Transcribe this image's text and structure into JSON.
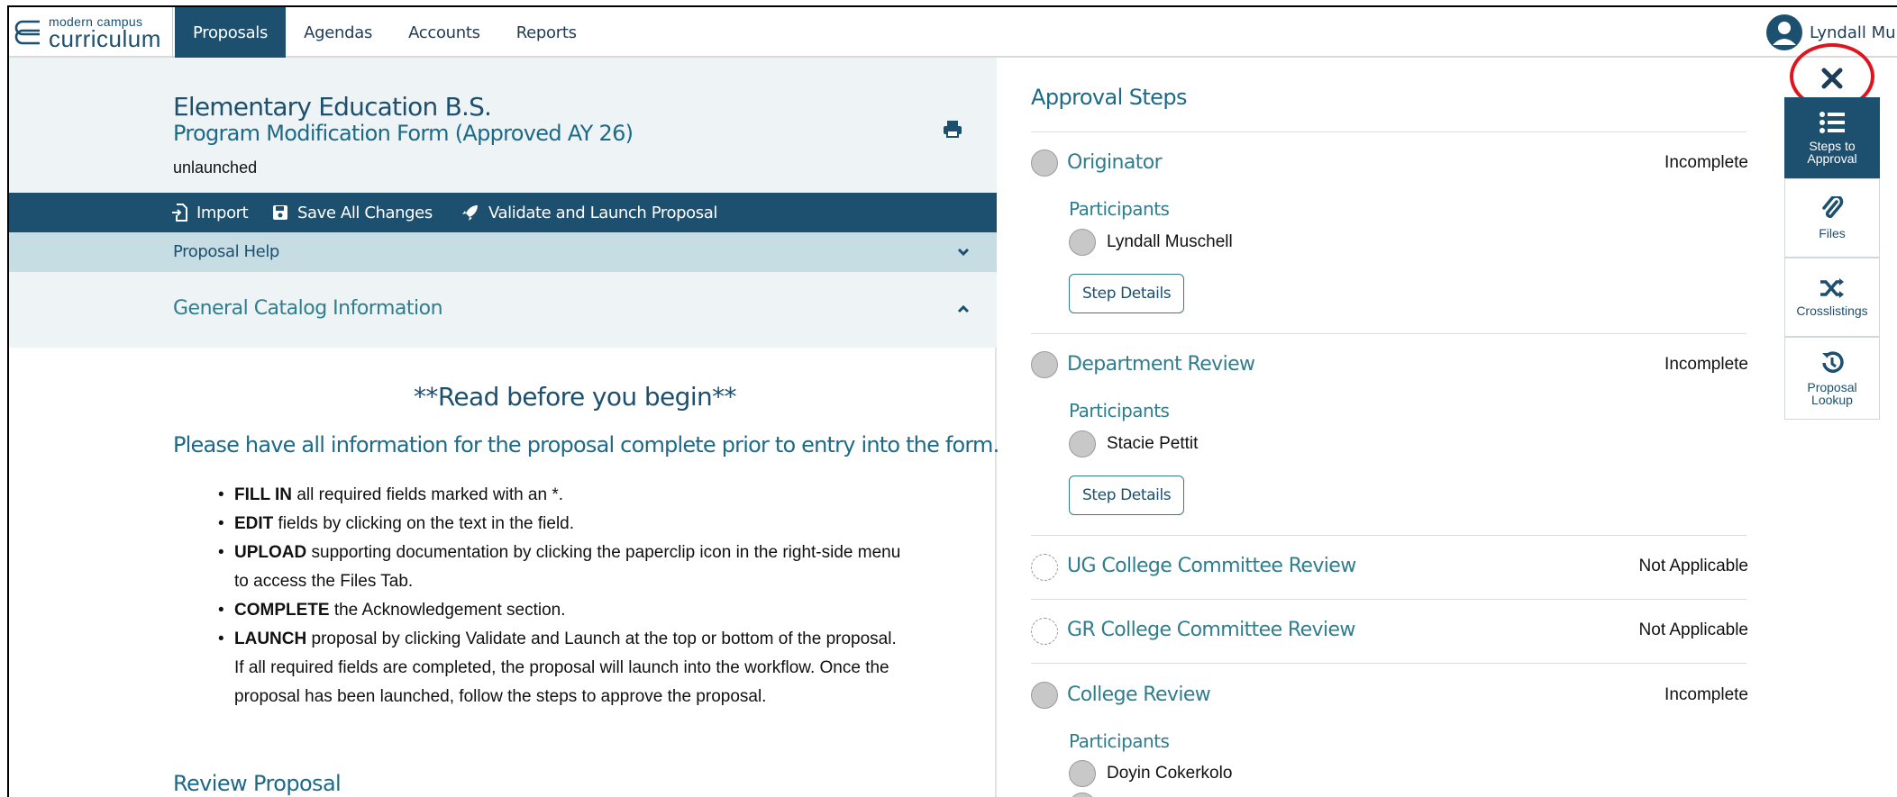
{
  "nav": {
    "logo_top": "modern campus",
    "logo_bottom": "curriculum",
    "tabs": [
      "Proposals",
      "Agendas",
      "Accounts",
      "Reports"
    ],
    "user": "Lyndall Mu"
  },
  "header": {
    "program_title": "Elementary Education B.S.",
    "form_name": "Program Modification Form (Approved AY 26)",
    "status": "unlaunched"
  },
  "actions": {
    "import": "Import",
    "save": "Save All Changes",
    "validate": "Validate and Launch Proposal"
  },
  "sections": {
    "help": "Proposal Help",
    "catalog": "General Catalog Information"
  },
  "content": {
    "read_heading": "**Read before you begin**",
    "please": "Please have all information for the proposal complete prior to entry into the form.",
    "instructions": [
      {
        "bold": "FILL IN",
        "text": " all required fields marked with an *."
      },
      {
        "bold": "EDIT",
        "text": " fields by clicking on the text in the field."
      },
      {
        "bold": "UPLOAD",
        "text": " supporting documentation by clicking the paperclip icon in the right-side menu to access the Files Tab."
      },
      {
        "bold": "COMPLETE",
        "text": " the Acknowledgement section."
      },
      {
        "bold": "LAUNCH",
        "text": " proposal by clicking Validate and Launch at the top or bottom of the proposal.  If all required fields are completed, the proposal will launch into the workflow. Once the proposal has been launched, follow the steps to approve the proposal."
      }
    ],
    "review_heading": "Review Proposal"
  },
  "approval": {
    "title": "Approval Steps",
    "participants_label": "Participants",
    "step_details_label": "Step Details",
    "steps": [
      {
        "name": "Originator",
        "status": "Incomplete",
        "participants": [
          "Lyndall Muschell"
        ]
      },
      {
        "name": "Department Review",
        "status": "Incomplete",
        "participants": [
          "Stacie Pettit"
        ]
      },
      {
        "name": "UG College Committee Review",
        "status": "Not Applicable",
        "participants": []
      },
      {
        "name": "GR College Committee Review",
        "status": "Not Applicable",
        "participants": []
      },
      {
        "name": "College Review",
        "status": "Incomplete",
        "participants": [
          "Doyin Cokerkolo"
        ]
      }
    ]
  },
  "sidemenu": {
    "items": [
      {
        "label": "Steps to Approval",
        "icon": "list-icon"
      },
      {
        "label": "Files",
        "icon": "paperclip-icon"
      },
      {
        "label": "Crosslistings",
        "icon": "shuffle-icon"
      },
      {
        "label": "Proposal Lookup",
        "icon": "history-icon"
      }
    ]
  },
  "colors": {
    "primary": "#1d4f6e",
    "teal": "#2f7d8d",
    "highlight_ring": "#e0141e"
  }
}
